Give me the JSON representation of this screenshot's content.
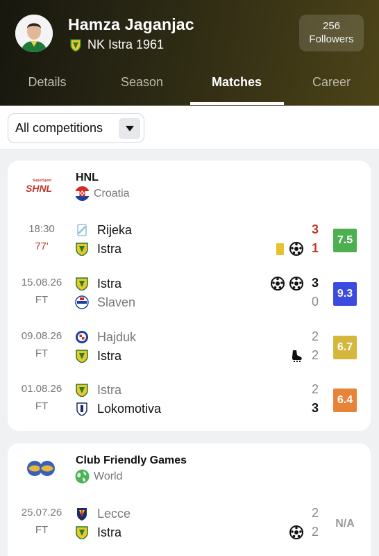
{
  "header": {
    "player_name": "Hamza Jaganjac",
    "team_name": "NK Istra 1961",
    "followers_count": "256",
    "followers_label": "Followers"
  },
  "tabs": [
    {
      "label": "Details",
      "active": false
    },
    {
      "label": "Season",
      "active": false
    },
    {
      "label": "Matches",
      "active": true
    },
    {
      "label": "Career",
      "active": false
    }
  ],
  "filter": {
    "selected": "All competitions"
  },
  "competitions": [
    {
      "league": "HNL",
      "country": "Croatia",
      "matches": [
        {
          "date": "18:30",
          "status": "77'",
          "live": true,
          "home": "Rijeka",
          "away": "Istra",
          "home_score": "3",
          "away_score": "1",
          "rating": "7.5",
          "rating_color": "#4caf50",
          "events": [
            "yellow-card-icon",
            "goal-icon"
          ]
        },
        {
          "date": "15.08.26",
          "status": "FT",
          "live": false,
          "home": "Istra",
          "away": "Slaven",
          "home_score": "3",
          "away_score": "0",
          "rating": "9.3",
          "rating_color": "#3b4be0",
          "events": [
            "goal-icon",
            "goal-icon"
          ]
        },
        {
          "date": "09.08.26",
          "status": "FT",
          "live": false,
          "home": "Hajduk",
          "away": "Istra",
          "home_score": "2",
          "away_score": "2",
          "rating": "6.7",
          "rating_color": "#d4b73c",
          "events": [
            "assist-boot-icon"
          ]
        },
        {
          "date": "01.08.26",
          "status": "FT",
          "live": false,
          "home": "Istra",
          "away": "Lokomotiva",
          "home_score": "2",
          "away_score": "3",
          "rating": "6.4",
          "rating_color": "#e8833a",
          "events": []
        }
      ]
    },
    {
      "league": "Club Friendly Games",
      "country": "World",
      "matches": [
        {
          "date": "25.07.26",
          "status": "FT",
          "live": false,
          "home": "Lecce",
          "away": "Istra",
          "home_score": "2",
          "away_score": "2",
          "rating": "N/A",
          "events": [
            "goal-icon"
          ]
        }
      ]
    }
  ]
}
